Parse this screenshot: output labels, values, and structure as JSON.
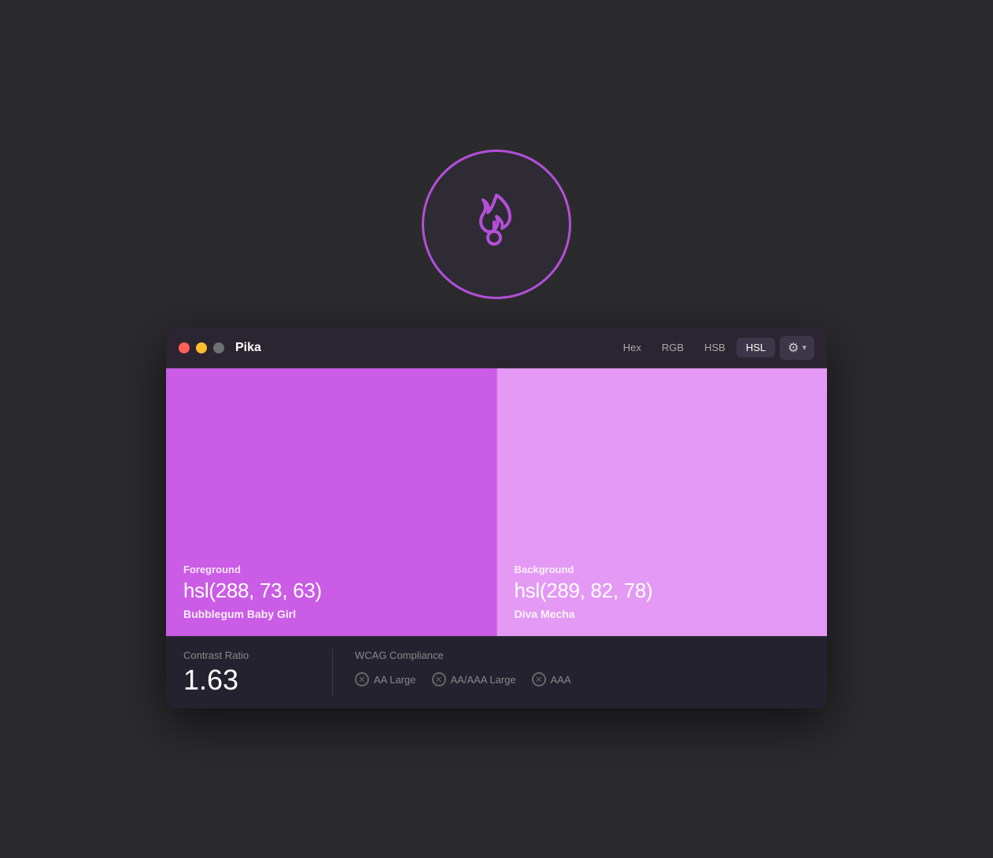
{
  "app": {
    "icon_label": "Pika flame icon"
  },
  "window": {
    "title": "Pika",
    "traffic_lights": {
      "close_label": "close",
      "minimize_label": "minimize",
      "maximize_label": "maximize"
    },
    "format_tabs": [
      {
        "label": "Hex",
        "active": false
      },
      {
        "label": "RGB",
        "active": false
      },
      {
        "label": "HSB",
        "active": false
      },
      {
        "label": "HSL",
        "active": true
      }
    ],
    "settings_label": "⚙",
    "chevron_label": "▾"
  },
  "foreground": {
    "label": "Foreground",
    "value": "hsl(288, 73, 63)",
    "name": "Bubblegum Baby Girl",
    "color": "hsl(288, 73%, 63%)"
  },
  "background": {
    "label": "Background",
    "value": "hsl(289, 82, 78)",
    "name": "Diva Mecha",
    "color": "hsl(289, 82%, 78%)"
  },
  "contrast": {
    "label": "Contrast Ratio",
    "value": "1.63"
  },
  "wcag": {
    "label": "WCAG Compliance",
    "items": [
      {
        "label": "AA Large",
        "icon": "✕"
      },
      {
        "label": "AA/AAA Large",
        "icon": "✕"
      },
      {
        "label": "AAA",
        "icon": "✕"
      }
    ]
  }
}
